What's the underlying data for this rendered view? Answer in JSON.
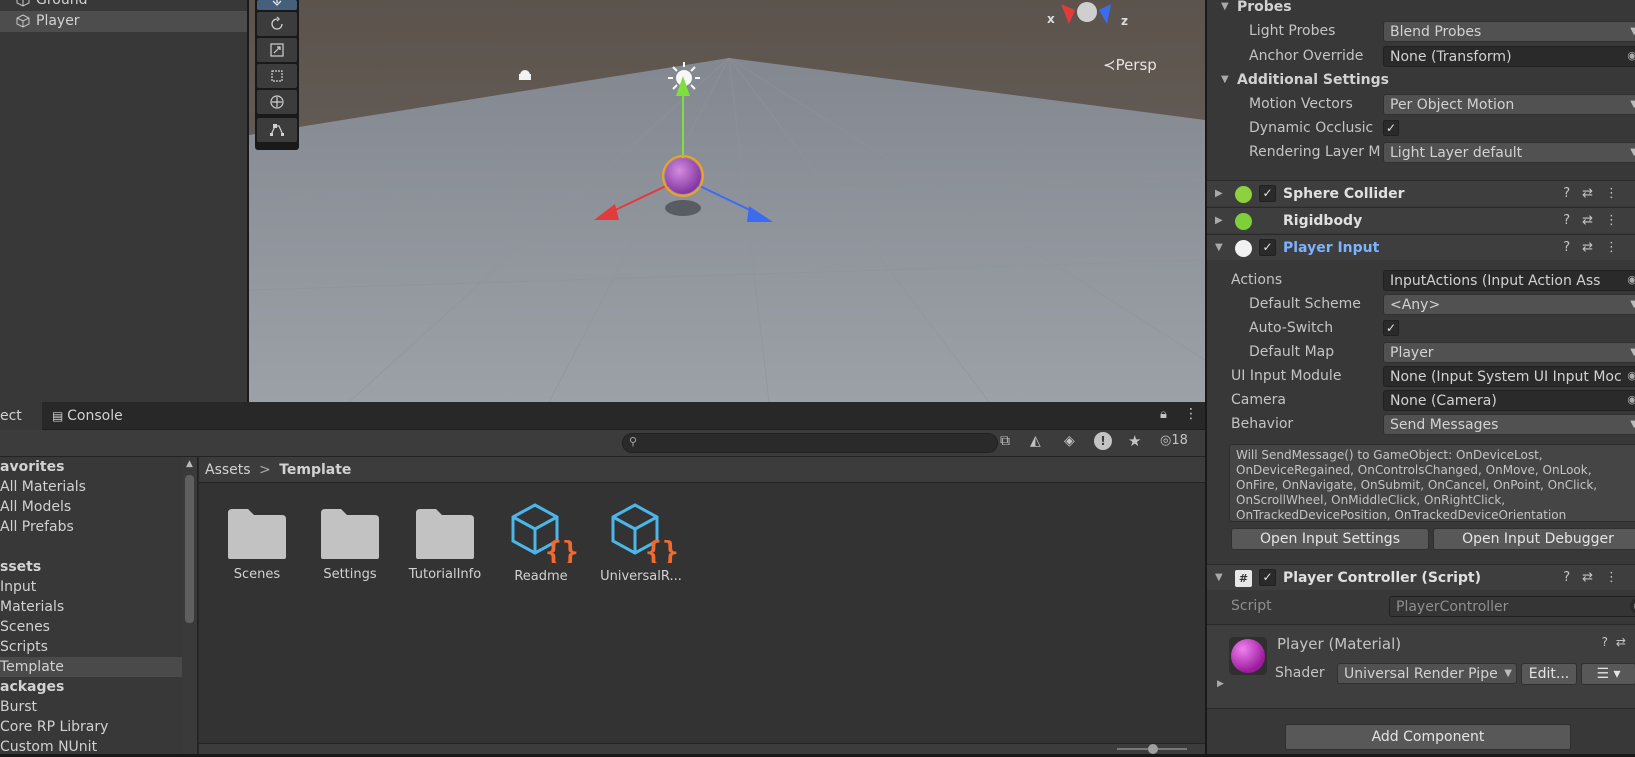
{
  "hierarchy": {
    "items": [
      {
        "label": "Ground",
        "selected": false
      },
      {
        "label": "Player",
        "selected": true
      }
    ]
  },
  "scene_view": {
    "projection_label": "≺Persp",
    "axis_x": "x",
    "axis_z": "z"
  },
  "inspector": {
    "probes": {
      "title": "Probes",
      "light_probes_label": "Light Probes",
      "light_probes_value": "Blend Probes",
      "anchor_override_label": "Anchor Override",
      "anchor_override_value": "None (Transform)"
    },
    "additional": {
      "title": "Additional Settings",
      "motion_vectors_label": "Motion Vectors",
      "motion_vectors_value": "Per Object Motion",
      "dynamic_occlusion_label": "Dynamic Occlusic",
      "rendering_layer_label": "Rendering Layer M",
      "rendering_layer_value": "Light Layer default"
    },
    "components": {
      "sphere_collider": "Sphere Collider",
      "rigidbody": "Rigidbody",
      "player_input": "Player Input",
      "player_controller": "Player Controller (Script)"
    },
    "player_input": {
      "actions_label": "Actions",
      "actions_value": "InputActions (Input Action Ass",
      "default_scheme_label": "Default Scheme",
      "default_scheme_value": "<Any>",
      "auto_switch_label": "Auto-Switch",
      "default_map_label": "Default Map",
      "default_map_value": "Player",
      "ui_input_module_label": "UI Input Module",
      "ui_input_module_value": "None (Input System UI Input Moc",
      "camera_label": "Camera",
      "camera_value": "None (Camera)",
      "behavior_label": "Behavior",
      "behavior_value": "Send Messages",
      "message_line1": "Will SendMessage() to GameObject: OnDeviceLost,",
      "message_line2": "OnDeviceRegained, OnControlsChanged, OnMove, OnLook,",
      "message_line3": "OnFire, OnNavigate, OnSubmit, OnCancel, OnPoint, OnClick,",
      "message_line4": "OnScrollWheel, OnMiddleClick, OnRightClick,",
      "message_line5": "OnTrackedDevicePosition, OnTrackedDeviceOrientation",
      "open_settings_button": "Open Input Settings",
      "open_debugger_button": "Open Input Debugger"
    },
    "player_controller": {
      "script_label": "Script",
      "script_value": "PlayerController"
    },
    "material": {
      "name": "Player (Material)",
      "shader_label": "Shader",
      "shader_value": "Universal Render Pipe",
      "edit_button": "Edit..."
    },
    "add_component_button": "Add Component"
  },
  "bottom_panel": {
    "tabs": {
      "project": "ect",
      "console": "Console"
    },
    "hidden_count": "18",
    "project_tree": [
      {
        "label": "avorites",
        "type": "head"
      },
      {
        "label": "All Materials",
        "type": "item"
      },
      {
        "label": "All Models",
        "type": "item"
      },
      {
        "label": "All Prefabs",
        "type": "item"
      },
      {
        "label": "",
        "type": "spacer"
      },
      {
        "label": "ssets",
        "type": "head"
      },
      {
        "label": "Input",
        "type": "item"
      },
      {
        "label": "Materials",
        "type": "item"
      },
      {
        "label": "Scenes",
        "type": "item"
      },
      {
        "label": "Scripts",
        "type": "item"
      },
      {
        "label": "Template",
        "type": "item",
        "selected": true
      },
      {
        "label": "ackages",
        "type": "head"
      },
      {
        "label": "Burst",
        "type": "item"
      },
      {
        "label": "Core RP Library",
        "type": "item"
      },
      {
        "label": "Custom NUnit",
        "type": "item"
      }
    ],
    "breadcrumb": {
      "root": "Assets",
      "separator": ">",
      "current": "Template"
    },
    "assets": [
      {
        "label": "Scenes",
        "kind": "folder"
      },
      {
        "label": "Settings",
        "kind": "folder"
      },
      {
        "label": "TutorialInfo",
        "kind": "folder"
      },
      {
        "label": "Readme",
        "kind": "script-asset"
      },
      {
        "label": "UniversalR...",
        "kind": "script-asset"
      }
    ]
  },
  "colors": {
    "accent_blue": "#7cb3ff",
    "selection": "#4d4d4d",
    "axis_x": "#e23b3b",
    "axis_y": "#7ee03e",
    "axis_z": "#3b6cf0",
    "asset_icon_blue": "#4cb6e8",
    "asset_icon_orange": "#f26a2e"
  }
}
